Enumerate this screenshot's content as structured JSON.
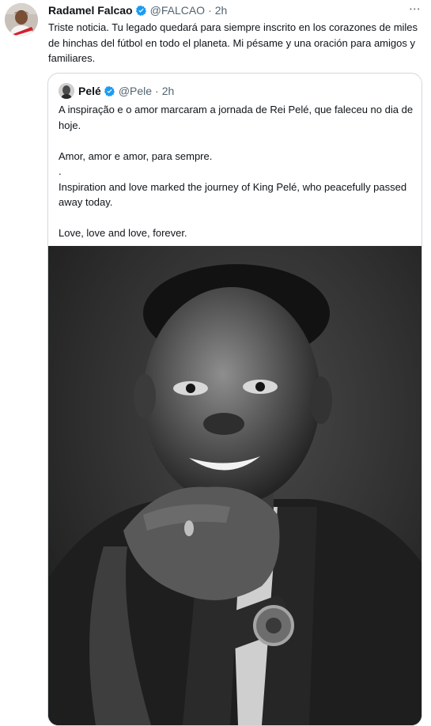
{
  "tweet": {
    "author_name": "Radamel Falcao",
    "handle": "@FALCAO",
    "separator": "·",
    "time": "2h",
    "more_icon": "⋯",
    "text": "Triste noticia. Tu legado quedará para siempre inscrito en los corazones de miles de hinchas del fútbol en todo el planeta. Mi pésame y una oración para amigos y familiares."
  },
  "quoted": {
    "author_name": "Pelé",
    "handle": "@Pele",
    "separator": "·",
    "time": "2h",
    "text": "A inspiração e o amor marcaram a jornada de Rei Pelé, que faleceu no dia de hoje.\n\nAmor, amor e amor, para sempre.\n.\nInspiration and love marked the journey of King Pelé, who peacefully passed away today.\n\nLove, love and love, forever."
  },
  "colors": {
    "verified": "#1d9bf0",
    "text": "#0f1419",
    "muted": "#536471",
    "border": "#cfd9de"
  },
  "icons": {
    "verified": "verified-badge-icon",
    "more": "more-options-icon"
  }
}
